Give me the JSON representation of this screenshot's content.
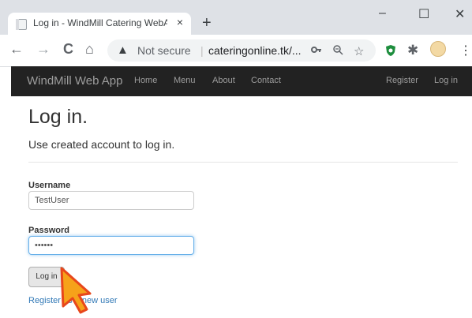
{
  "browser": {
    "tab_title": "Log in - WindMill Catering WebA",
    "tab_close": "×",
    "new_tab": "+",
    "window_minimize": "–",
    "window_maximize": "☐",
    "window_close": "✕",
    "nav_back": "←",
    "nav_forward": "→",
    "nav_reload": "C",
    "nav_home": "⌂",
    "security_icon": "▲",
    "security_label": "Not secure",
    "url": "cateringonline.tk/...",
    "menu": "⋮"
  },
  "navbar": {
    "brand": "WindMill Web App",
    "links": [
      "Home",
      "Menu",
      "About",
      "Contact"
    ],
    "register": "Register",
    "login": "Log in"
  },
  "page": {
    "title": "Log in.",
    "subtitle": "Use created account to log in.",
    "username_label": "Username",
    "username_value": "TestUser",
    "password_label": "Password",
    "password_value": "••••••",
    "login_button": "Log in",
    "register_link": "Register as a new user"
  },
  "colors": {
    "navbar_bg": "#222222",
    "link": "#337ab7",
    "focus": "#66afe9"
  }
}
